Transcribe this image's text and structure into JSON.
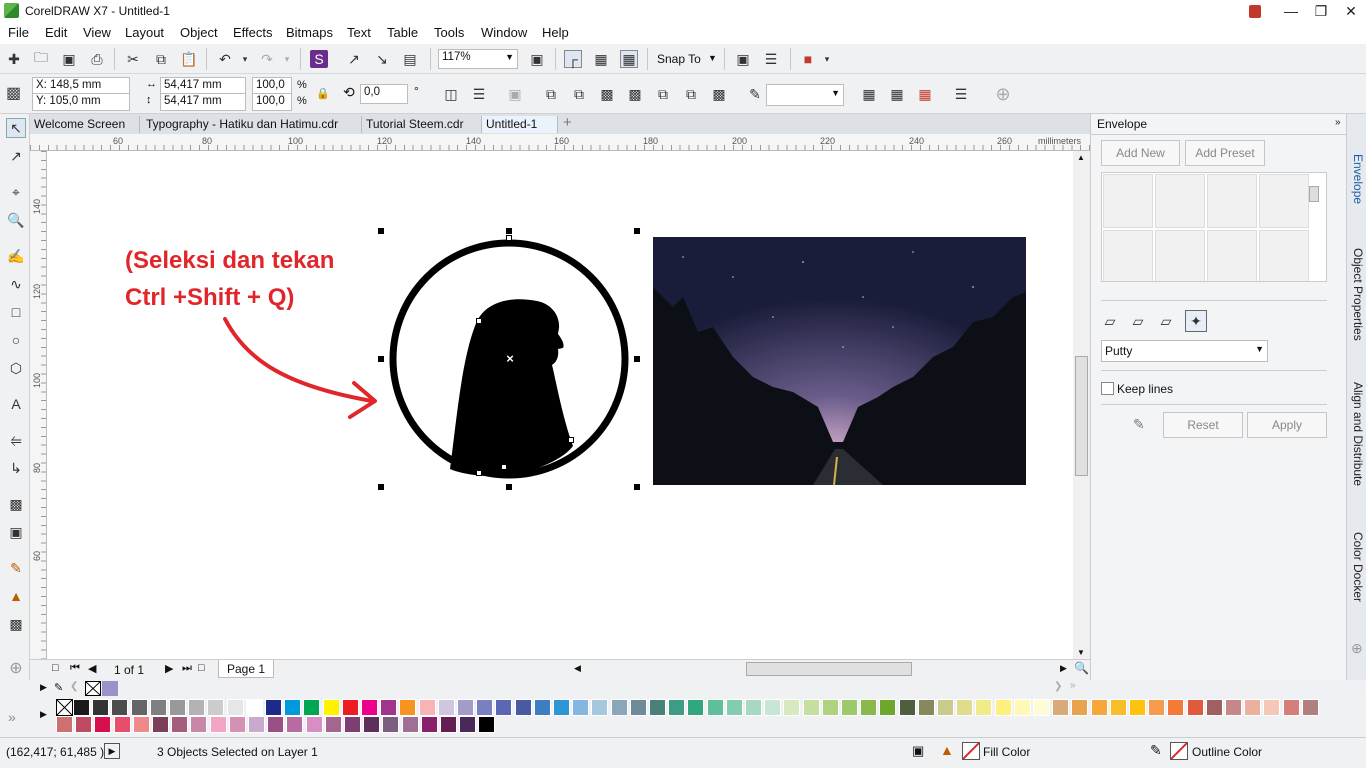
{
  "window": {
    "title": "CorelDRAW X7 - Untitled-1"
  },
  "menu": [
    "File",
    "Edit",
    "View",
    "Layout",
    "Object",
    "Effects",
    "Bitmaps",
    "Text",
    "Table",
    "Tools",
    "Window",
    "Help"
  ],
  "toolbar": {
    "zoom": "117%",
    "snap_to": "Snap To"
  },
  "props": {
    "x": "X: 148,5 mm",
    "y": "Y: 105,0 mm",
    "width": "54,417 mm",
    "height": "54,417 mm",
    "scale_x": "100,0",
    "scale_y": "100,0",
    "pct": "%",
    "rotation": "0,0",
    "deg": "°"
  },
  "tabs": [
    "Welcome Screen",
    "Typography - Hatiku dan Hatimu.cdr",
    "Tutorial Steem.cdr",
    "Untitled-1"
  ],
  "ruler": {
    "h_ticks": [
      "60",
      "80",
      "100",
      "120",
      "140",
      "160",
      "180",
      "200",
      "220",
      "240",
      "260"
    ],
    "v_ticks": [
      "140",
      "120",
      "100",
      "80",
      "60"
    ],
    "unit": "millimeters"
  },
  "canvas": {
    "annotation_line1": "(Seleksi dan tekan",
    "annotation_line2": "Ctrl +Shift + Q)",
    "annotation_color": "#e0262b"
  },
  "pagenav": {
    "counter": "1 of 1",
    "page_tab": "Page 1"
  },
  "docker": {
    "title": "Envelope",
    "add_new": "Add New",
    "add_preset": "Add Preset",
    "mode": "Putty",
    "keep_lines": "Keep lines",
    "reset": "Reset",
    "apply": "Apply"
  },
  "side_tabs": [
    "Envelope",
    "Object Properties",
    "Align and Distribute",
    "Color Docker"
  ],
  "palette": {
    "row1": [
      "#1a1a1a",
      "#333333",
      "#4d4d4d",
      "#666666",
      "#808080",
      "#999999",
      "#b3b3b3",
      "#cccccc",
      "#e6e6e6",
      "#ffffff",
      "#1d2a8a",
      "#0099dd",
      "#00a651",
      "#fff200",
      "#ed1c24",
      "#ec008c",
      "#a0358c",
      "#f7941d",
      "#f9b3b3",
      "#cfc7dd",
      "#a39bc8",
      "#7a7fc2",
      "#5a67b3",
      "#4a5aa0",
      "#3e7ec0",
      "#2f96d6",
      "#83b6e1",
      "#a7c7de",
      "#8aa6b8",
      "#6f8b99",
      "#4b7f7a",
      "#3e9b85",
      "#31a77d",
      "#5fbf9a",
      "#82ccb0",
      "#a6d8c4",
      "#c7e6d7",
      "#d8e9c0",
      "#c5df9e",
      "#afd27f",
      "#9bc96b",
      "#8ab84c",
      "#6fa62c",
      "#4f5f3e",
      "#87885e",
      "#c9cb8d",
      "#e0dc8e",
      "#f0ec8a",
      "#fdf07e",
      "#fff9b5",
      "#fefcd5",
      "#d8aa78",
      "#e8a350",
      "#f6a73c",
      "#f7be28",
      "#ffc20e",
      "#f59d4d",
      "#f47a38",
      "#e05a3c",
      "#a06060",
      "#c48888",
      "#ecb0a0",
      "#f5c7b6",
      "#d67f7a",
      "#b08080"
    ],
    "row2": [
      "#cf7070",
      "#c14a63",
      "#d6104f",
      "#e64e6b",
      "#f08a8a",
      "#7d3e5a",
      "#a55d7d",
      "#c987a8",
      "#f3a5c6",
      "#d590b5",
      "#c9a9cd",
      "#9a4f87",
      "#b86aa3",
      "#d88ec5",
      "#a3678f",
      "#7e3d73",
      "#5e2f5a",
      "#7c5f80",
      "#a06f95",
      "#8a1f6b",
      "#661d54",
      "#4a2859",
      "#000000"
    ]
  },
  "status": {
    "coords": "(162,417; 61,485 )",
    "selection": "3 Objects Selected on Layer 1",
    "fill": "Fill Color",
    "outline": "Outline Color"
  }
}
